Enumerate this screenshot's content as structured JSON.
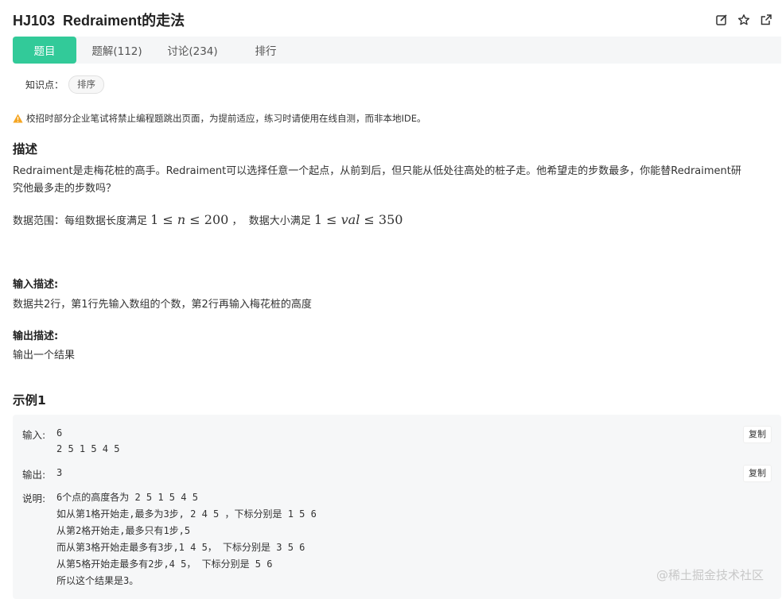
{
  "title": "HJ103  Redraiment的走法",
  "title_icons": [
    "edit-icon",
    "star-icon",
    "external-link-icon"
  ],
  "tabs": [
    {
      "label": "题目",
      "active": true
    },
    {
      "label": "题解(112)"
    },
    {
      "label": "讨论(234)"
    },
    {
      "label": "排行"
    }
  ],
  "knowledge": {
    "label": "知识点：",
    "tag": "排序"
  },
  "notice": "校招时部分企业笔试将禁止编程题跳出页面，为提前适应，练习时请使用在线自测，而非本地IDE。",
  "description": {
    "heading": "描述",
    "line1": "Redraiment是走梅花桩的高手。Redraiment可以选择任意一个起点，从前到后，但只能从低处往高处的桩子走。他希望走的步数最多，你能替Redraiment研",
    "line2": "究他最多走的步数吗？",
    "range_label": "数据范围：每组数据长度满足 ",
    "range_expr1_a": "1 ≤ ",
    "range_expr1_var": "n",
    "range_expr1_b": " ≤ 200",
    "range_sep": " ，  数据大小满足 ",
    "range_expr2_a": "1 ≤ ",
    "range_expr2_var": "val",
    "range_expr2_b": " ≤ 350"
  },
  "input_desc": {
    "heading": "输入描述:",
    "text": "数据共2行，第1行先输入数组的个数，第2行再输入梅花桩的高度"
  },
  "output_desc": {
    "heading": "输出描述:",
    "text": "输出一个结果"
  },
  "example": {
    "heading": "示例1",
    "input_label": "输入:",
    "input_line1": "6",
    "input_line2": "2 5 1 5 4 5",
    "output_label": "输出:",
    "output_value": "3",
    "explain_label": "说明:",
    "explain_lines": [
      "6个点的高度各为 2 5 1 5 4 5",
      "如从第1格开始走,最多为3步, 2 4 5 ，下标分别是 1 5 6",
      "从第2格开始走,最多只有1步,5",
      "而从第3格开始走最多有3步,1 4 5， 下标分别是 3 5 6",
      "从第5格开始走最多有2步,4 5， 下标分别是 5 6",
      "所以这个结果是3。"
    ],
    "copy_label": "复制"
  },
  "watermark": "@稀土掘金技术社区"
}
